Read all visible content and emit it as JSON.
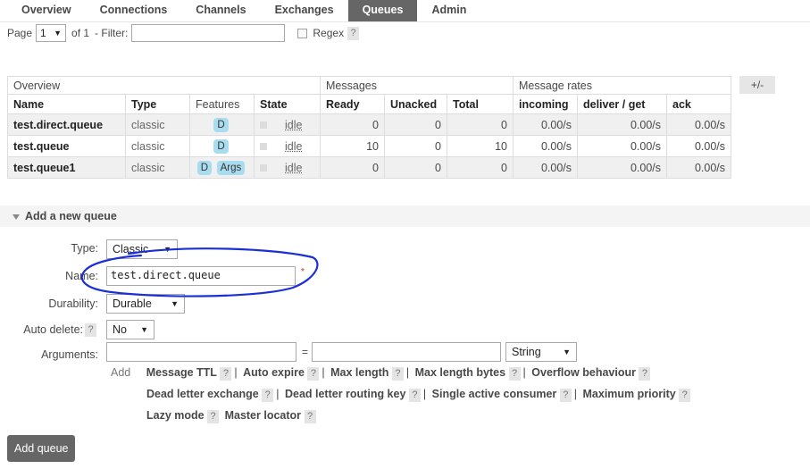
{
  "nav": {
    "tabs": [
      {
        "label": "Overview"
      },
      {
        "label": "Connections"
      },
      {
        "label": "Channels"
      },
      {
        "label": "Exchanges"
      },
      {
        "label": "Queues",
        "selected": true
      },
      {
        "label": "Admin"
      }
    ]
  },
  "pager": {
    "page_label": "Page",
    "page_value": "1",
    "of_label": "of 1",
    "filter_label": "- Filter:",
    "filter_value": "",
    "regex_label": "Regex",
    "help": "?"
  },
  "table": {
    "group_headers": [
      "Overview",
      "Messages",
      "Message rates"
    ],
    "plus_minus": "+/-",
    "columns": [
      "Name",
      "Type",
      "Features",
      "State",
      "Ready",
      "Unacked",
      "Total",
      "incoming",
      "deliver / get",
      "ack"
    ],
    "rows": [
      {
        "name": "test.direct.queue",
        "type": "classic",
        "features": [
          "D"
        ],
        "state": "idle",
        "ready": "0",
        "unacked": "0",
        "total": "0",
        "incoming": "0.00/s",
        "deliver_get": "0.00/s",
        "ack": "0.00/s"
      },
      {
        "name": "test.queue",
        "type": "classic",
        "features": [
          "D"
        ],
        "state": "idle",
        "ready": "10",
        "unacked": "0",
        "total": "10",
        "incoming": "0.00/s",
        "deliver_get": "0.00/s",
        "ack": "0.00/s"
      },
      {
        "name": "test.queue1",
        "type": "classic",
        "features": [
          "D",
          "Args"
        ],
        "state": "idle",
        "ready": "0",
        "unacked": "0",
        "total": "0",
        "incoming": "0.00/s",
        "deliver_get": "0.00/s",
        "ack": "0.00/s"
      }
    ]
  },
  "add_queue": {
    "section_title": "Add a new queue",
    "type_label": "Type:",
    "type_value": "Classic",
    "name_label": "Name:",
    "name_value": "test.direct.queue",
    "required_mark": "*",
    "durability_label": "Durability:",
    "durability_value": "Durable",
    "auto_delete_label": "Auto delete:",
    "auto_delete_help": "?",
    "auto_delete_value": "No",
    "arguments_label": "Arguments:",
    "arg_key_value": "",
    "arg_eq": "=",
    "arg_value": "",
    "arg_type_value": "String",
    "add_label": "Add",
    "arg_links_line1": [
      "Message TTL",
      "Auto expire",
      "Max length",
      "Max length bytes",
      "Overflow behaviour"
    ],
    "arg_links_line2": [
      "Dead letter exchange",
      "Dead letter routing key",
      "Single active consumer",
      "Maximum priority"
    ],
    "arg_links_line3": [
      "Lazy mode",
      "Master locator"
    ],
    "help": "?",
    "separator": "|",
    "submit_label": "Add queue"
  },
  "colors": {
    "nav_selected_bg": "#666666",
    "feature_badge": "#aadcf0",
    "row_alt": "#f0f0f0",
    "annotation_ink": "#1a2fd6",
    "required": "#dd2222"
  }
}
